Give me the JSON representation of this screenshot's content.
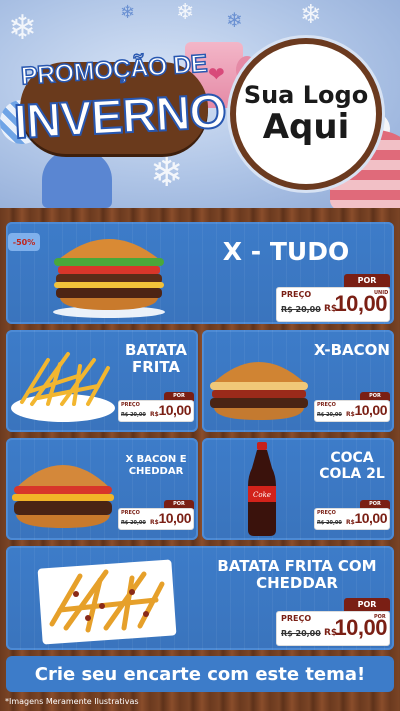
{
  "header": {
    "title_line1": "PROMOÇÃO DE",
    "title_line2": "INVERNO",
    "logo_line1": "Sua Logo",
    "logo_line2": "Aqui"
  },
  "products": [
    {
      "name": "X - TUDO",
      "por": "POR",
      "preco": "PREÇO",
      "old": "R$ 20,00",
      "currency": "R$",
      "price": "10,00",
      "unit": "UNID",
      "image": "burger-xtudo",
      "discount": "-50%"
    },
    {
      "name": "BATATA FRITA",
      "por": "POR",
      "preco": "PREÇO",
      "old": "R$ 20,00",
      "currency": "R$",
      "price": "10,00",
      "image": "fries"
    },
    {
      "name": "X-BACON",
      "por": "POR",
      "preco": "PREÇO",
      "old": "R$ 20,00",
      "currency": "R$",
      "price": "10,00",
      "image": "burger-bacon"
    },
    {
      "name": "X BACON E CHEDDAR",
      "por": "POR",
      "preco": "PREÇO",
      "old": "R$ 20,00",
      "currency": "R$",
      "price": "10,00",
      "image": "burger-cheddar"
    },
    {
      "name": "COCA COLA 2L",
      "por": "POR",
      "preco": "PREÇO",
      "old": "R$ 20,00",
      "currency": "R$",
      "price": "10,00",
      "image": "coke-bottle"
    },
    {
      "name": "BATATA FRITA COM CHEDDAR",
      "por": "POR",
      "preco": "PREÇO",
      "old": "R$ 20,00",
      "currency": "R$",
      "price": "10,00",
      "unit": "POR",
      "image": "fries-cheddar"
    }
  ],
  "cta": "Crie seu encarte com este tema!",
  "disclaimer": "*Imagens Meramente Ilustrativas",
  "colors": {
    "panel_blue": "#3d7cc9",
    "wood": "#6b3a1f",
    "price_red": "#7a1f14"
  }
}
